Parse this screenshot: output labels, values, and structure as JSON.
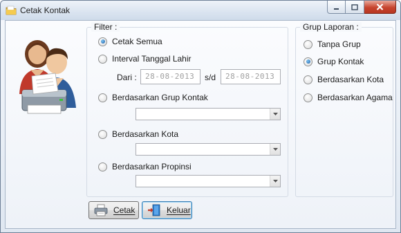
{
  "window": {
    "title": "Cetak Kontak",
    "icon": "folder-icon"
  },
  "filter": {
    "title": "Filter :",
    "options": [
      {
        "label": "Cetak Semua",
        "checked": true
      },
      {
        "label": "Interval Tanggal Lahir",
        "checked": false
      },
      {
        "label": "Berdasarkan Grup Kontak",
        "checked": false
      },
      {
        "label": "Berdasarkan Kota",
        "checked": false
      },
      {
        "label": "Berdasarkan Propinsi",
        "checked": false
      }
    ],
    "date_from_label": "Dari :",
    "date_from_value": "28-08-2013",
    "date_sep_label": "s/d",
    "date_to_value": "28-08-2013",
    "grup_kontak_value": "",
    "kota_value": "",
    "propinsi_value": ""
  },
  "grup_laporan": {
    "title": "Grup Laporan :",
    "options": [
      {
        "label": "Tanpa Grup",
        "checked": false
      },
      {
        "label": "Grup Kontak",
        "checked": true
      },
      {
        "label": "Berdasarkan Kota",
        "checked": false
      },
      {
        "label": "Berdasarkan Agama",
        "checked": false
      }
    ]
  },
  "buttons": {
    "cetak_label": "Cetak",
    "cetak_icon": "printer-icon",
    "keluar_label": "Keluar",
    "keluar_icon": "exit-door-icon"
  },
  "colors": {
    "radio_checked": "#1b5ea7",
    "close_button": "#c7442e",
    "date_text_disabled": "#a0a0a0"
  }
}
